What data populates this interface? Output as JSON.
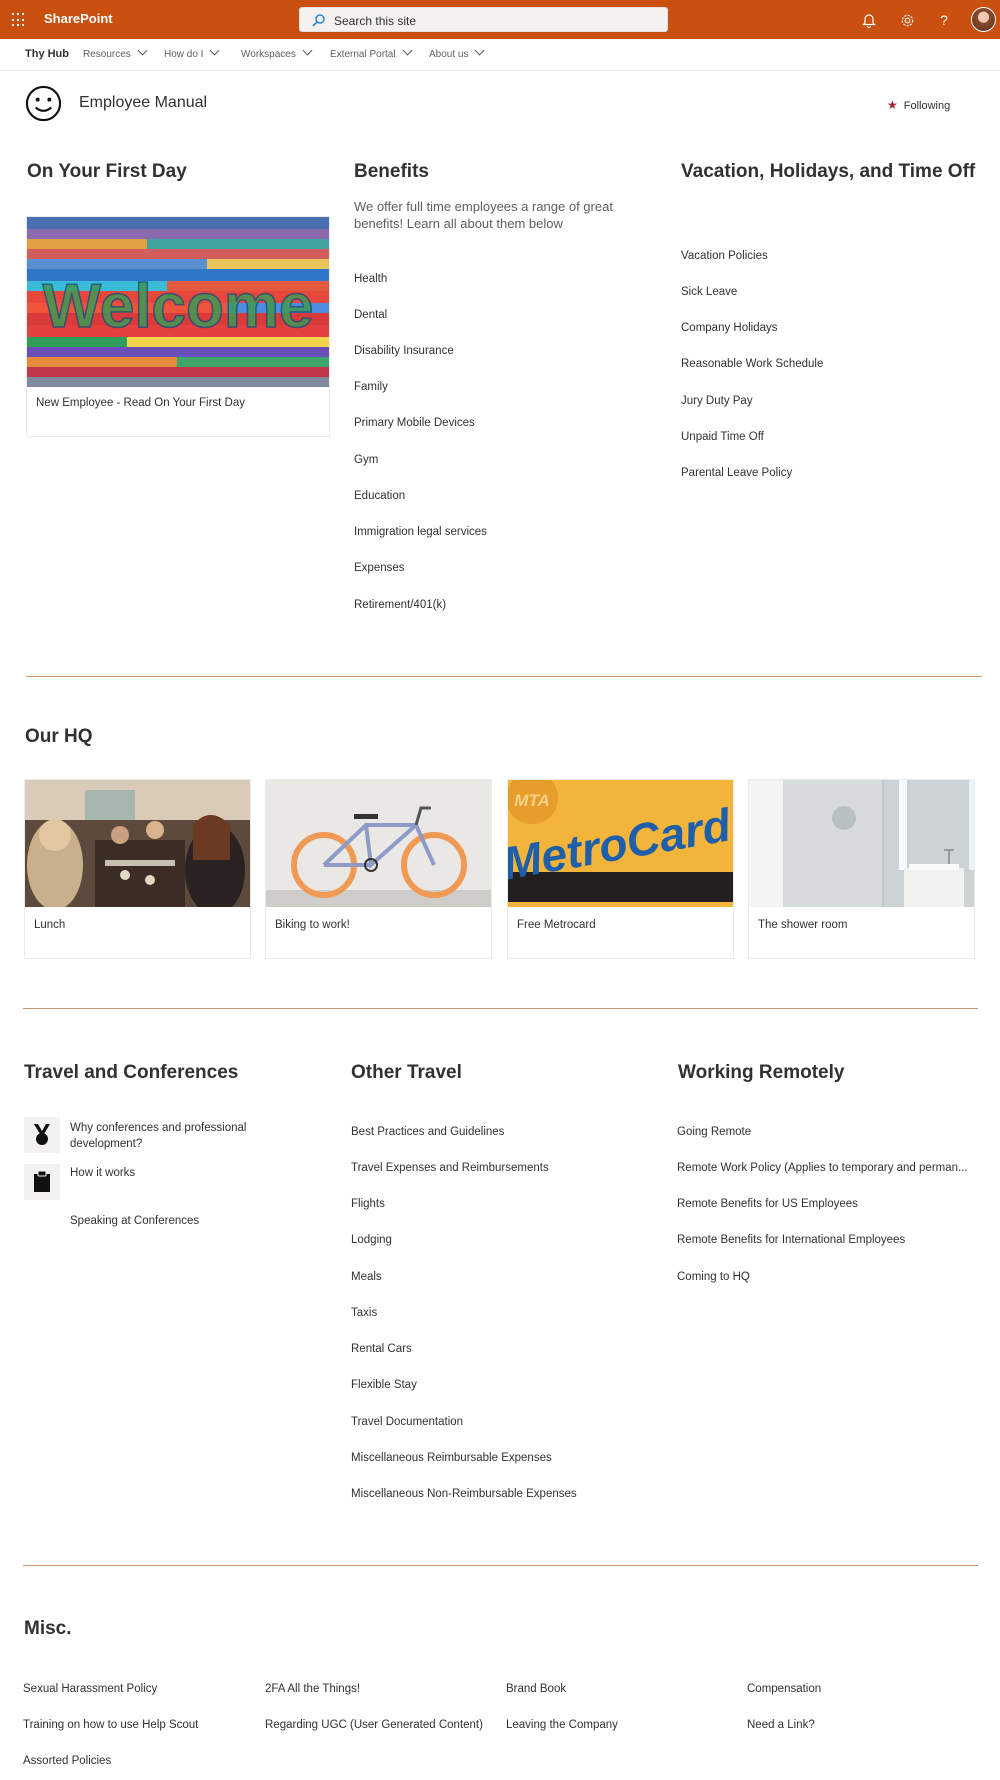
{
  "suite_bar": {
    "app_name": "SharePoint",
    "search_placeholder": "Search this site",
    "accent_color": "#ca5010",
    "icons": [
      "app-launcher-icon",
      "search-icon",
      "bell-icon",
      "gear-icon",
      "help-icon",
      "avatar"
    ]
  },
  "nav": {
    "hub": "Thy Hub",
    "items": [
      {
        "label": "Resources"
      },
      {
        "label": "How do I"
      },
      {
        "label": "Workspaces"
      },
      {
        "label": "External Portal"
      },
      {
        "label": "About us"
      }
    ]
  },
  "site": {
    "title": "Employee Manual",
    "follow_label": "Following"
  },
  "first_day": {
    "heading": "On Your First Day",
    "card_caption": "New Employee - Read On Your First Day",
    "image_text": "Welcome"
  },
  "benefits": {
    "heading": "Benefits",
    "description": "We offer full time employees a range of great benefits! Learn all about them below",
    "links": [
      "Health",
      "Dental",
      "Disability Insurance",
      "Family",
      "Primary Mobile Devices",
      "Gym",
      "Education",
      "Immigration legal services",
      "Expenses",
      "Retirement/401(k)"
    ]
  },
  "vacation": {
    "heading": "Vacation, Holidays, and Time Off",
    "links": [
      "Vacation Policies",
      "Sick Leave",
      "Company Holidays",
      "Reasonable Work Schedule",
      "Jury Duty Pay",
      "Unpaid Time Off",
      "Parental Leave Policy"
    ]
  },
  "hq": {
    "heading": "Our HQ",
    "cards": [
      {
        "caption": "Lunch"
      },
      {
        "caption": "Biking to work!"
      },
      {
        "caption": "Free Metrocard",
        "image_text": "MetroCard",
        "image_badge": "MTA"
      },
      {
        "caption": "The shower room"
      }
    ]
  },
  "travel": {
    "heading": "Travel and Conferences",
    "links": [
      {
        "label": "Why conferences and professional development?",
        "icon": "medal-icon"
      },
      {
        "label": "How it works",
        "icon": "clipboard-icon"
      },
      {
        "label": "Speaking at Conferences",
        "icon": ""
      }
    ]
  },
  "other_travel": {
    "heading": "Other Travel",
    "links": [
      "Best Practices and Guidelines",
      "Travel Expenses and Reimbursements",
      "Flights",
      "Lodging",
      "Meals",
      "Taxis",
      "Rental Cars",
      "Flexible Stay",
      "Travel Documentation",
      "Miscellaneous Reimbursable Expenses",
      "Miscellaneous Non-Reimbursable Expenses"
    ]
  },
  "remote": {
    "heading": "Working Remotely",
    "links": [
      "Going Remote",
      "Remote Work Policy (Applies to temporary and perman...",
      "Remote Benefits for US Employees",
      "Remote Benefits for International Employees",
      "Coming to HQ"
    ]
  },
  "misc": {
    "heading": "Misc.",
    "links": [
      "Sexual Harassment Policy",
      "2FA All the Things!",
      "Brand Book",
      "Compensation",
      "Training on how to use Help Scout",
      "Regarding UGC (User Generated Content)",
      "Leaving the Company",
      "Need a Link?",
      "Assorted Policies"
    ]
  }
}
